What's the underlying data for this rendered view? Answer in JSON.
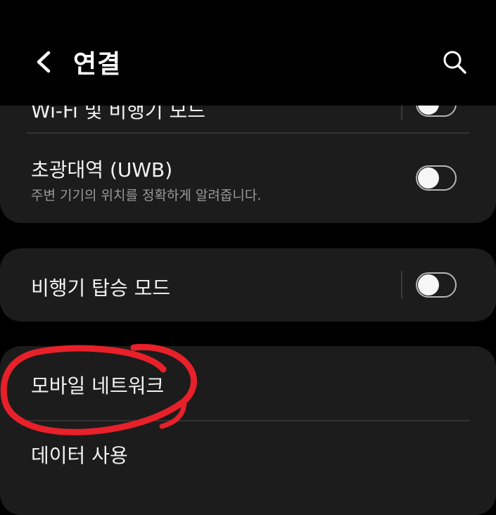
{
  "header": {
    "title": "연결",
    "back_icon": "chevron-left-icon",
    "search_icon": "search-icon"
  },
  "settings": {
    "partial_item": {
      "title": "Wi-Fi 및 비행기 모드"
    },
    "uwb": {
      "title": "초광대역 (UWB)",
      "subtitle": "주변 기기의 위치를 정확하게 알려줍니다.",
      "enabled": false
    },
    "airplane_mode": {
      "title": "비행기 탑승 모드",
      "enabled": false
    },
    "mobile_network": {
      "title": "모바일 네트워크"
    },
    "data_usage": {
      "title": "데이터 사용"
    }
  },
  "colors": {
    "background": "#000000",
    "card": "#1c1c1c",
    "text_primary": "#f2f2f2",
    "text_secondary": "#9a9a9a",
    "annotation": "#e8202a"
  }
}
